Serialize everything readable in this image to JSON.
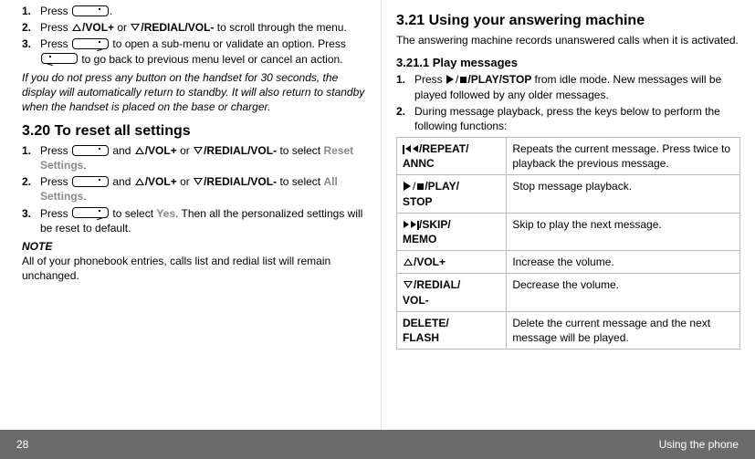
{
  "left": {
    "steps_top": {
      "s1": "Press ",
      "s1b": ".",
      "s2a": "Press ",
      "s2_vol_up": "/VOL+",
      "s2_or": " or ",
      "s2_vol_dn": "/REDIAL/VOL-",
      "s2b": " to scroll through the menu.",
      "s3a": "Press ",
      "s3b": " to open a sub-menu or validate an option. Press ",
      "s3c": " to go back to previous menu level or cancel an action."
    },
    "idle_note": "If you do not press any button on the handset for 30 seconds, the display will automatically return to standby. It will also return to standby when the handset is placed on the base or charger.",
    "h320": "3.20    To reset all settings",
    "steps_320": {
      "s1a": "Press ",
      "s1b": " and ",
      "s1_volup": "/VOL+",
      "s1_or": " or ",
      "s1_voldn": "/REDIAL/VOL-",
      "s1c": " to select ",
      "s1_reset": "Reset Settings",
      "s1d": ".",
      "s2a": "Press ",
      "s2b": " and ",
      "s2c": " to select ",
      "s2_all": "All Settings",
      "s2d": ".",
      "s3a": "Press ",
      "s3b": " to select ",
      "s3_yes": "Yes",
      "s3c": ". Then all the personalized settings will be reset to default."
    },
    "note_head": "NOTE",
    "note_body": "All of your phonebook entries, calls list and redial list will remain unchanged."
  },
  "right": {
    "h321": "3.21    Using your answering machine",
    "sub321": "The answering machine records unanswered calls when it is activated.",
    "h3211": "3.21.1   Play messages",
    "steps_3211": {
      "s1a": "Press ",
      "s1_key": "/PLAY/STOP",
      "s1b": " from idle mode. New messages will be played followed by any older messages.",
      "s2": "During message playback, press the keys below to perform the following functions:"
    },
    "table": {
      "r1_key": "/REPEAT/\nANNC",
      "r1_desc": "Repeats the current message. Press twice to playback the previous message.",
      "r2_key": "/PLAY/\nSTOP",
      "r2_desc": "Stop message playback.",
      "r3_key": "/SKIP/\nMEMO",
      "r3_desc": "Skip to play the next message.",
      "r4_key": "/VOL+",
      "r4_desc": "Increase the volume.",
      "r5_key": "/REDIAL/\nVOL-",
      "r5_desc": "Decrease the volume.",
      "r6_key": "DELETE/\nFLASH",
      "r6_desc": "Delete the current message and the next message will be played."
    }
  },
  "footer": {
    "page": "28",
    "section": "Using the phone"
  }
}
